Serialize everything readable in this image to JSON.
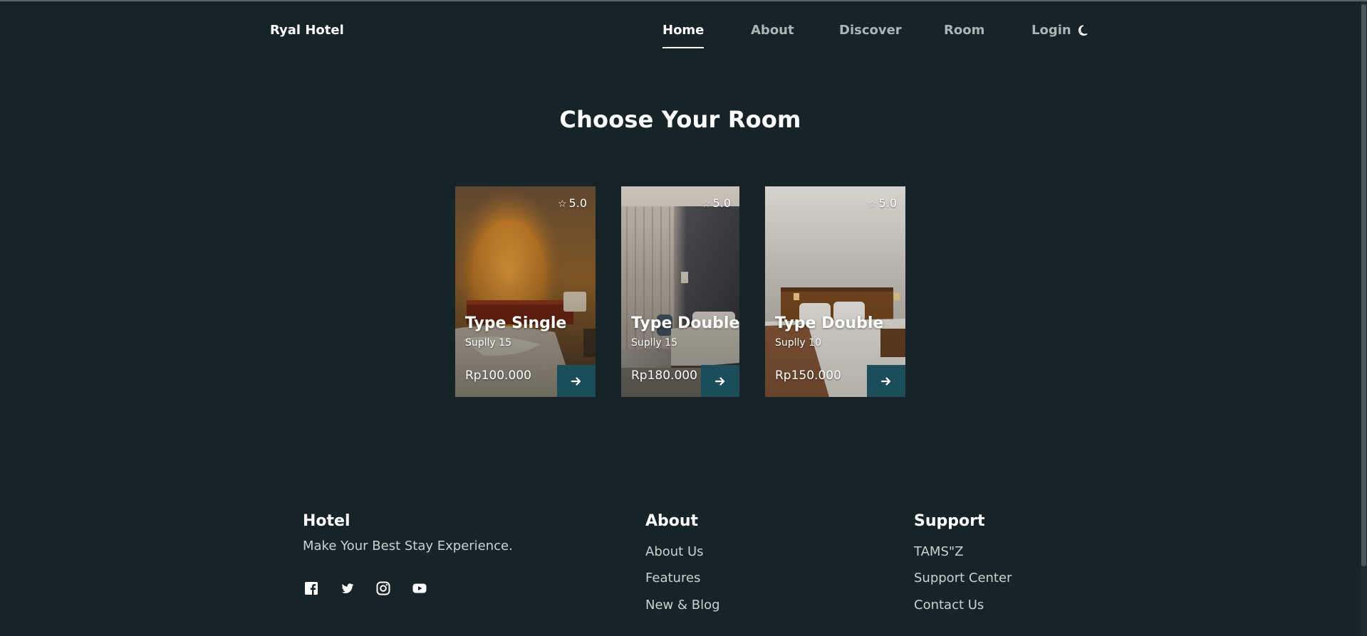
{
  "header": {
    "brand": "Ryal Hotel",
    "nav": [
      {
        "label": "Home",
        "active": true
      },
      {
        "label": "About",
        "active": false
      },
      {
        "label": "Discover",
        "active": false
      },
      {
        "label": "Room",
        "active": false
      },
      {
        "label": "Login",
        "active": false
      }
    ],
    "theme_icon": "moon-icon"
  },
  "section": {
    "title": "Choose Your Room"
  },
  "rooms": [
    {
      "title": "Type Single",
      "supply": "Suplly 15",
      "price": "Rp100.000",
      "rating": "5.0"
    },
    {
      "title": "Type Double",
      "supply": "Suplly 15",
      "price": "Rp180.000",
      "rating": "5.0"
    },
    {
      "title": "Type Double",
      "supply": "Suplly 10",
      "price": "Rp150.000",
      "rating": "5.0"
    }
  ],
  "footer": {
    "hotel": {
      "title": "Hotel",
      "tagline": "Make Your Best Stay Experience.",
      "social_icons": [
        "facebook-icon",
        "twitter-icon",
        "instagram-icon",
        "youtube-icon"
      ]
    },
    "about": {
      "title": "About",
      "links": [
        "About Us",
        "Features",
        "New & Blog"
      ]
    },
    "support": {
      "title": "Support",
      "links": [
        "TAMS\"Z",
        "Support Center",
        "Contact Us"
      ]
    }
  },
  "colors": {
    "background": "#172427",
    "button": "#1b4e5a",
    "nav_inactive": "#a9b5b6",
    "text": "#ffffff"
  }
}
